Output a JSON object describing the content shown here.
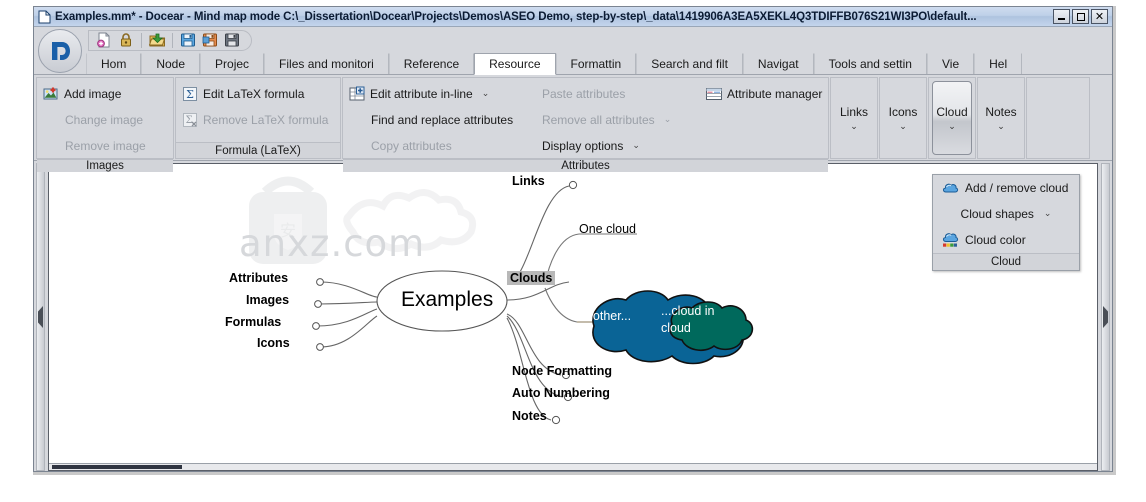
{
  "window": {
    "title": "Examples.mm* - Docear - Mind map mode C:\\_Dissertation\\Docear\\Projects\\Demos\\ASEO Demo, step-by-step\\_data\\1419906A3EA5XEKL4Q3TDIFFB076S21WI3PO\\default...",
    "title_icon": "document-icon",
    "controls": {
      "minimize": "minimize-icon",
      "maximize": "maximize-icon",
      "close": "close-icon"
    }
  },
  "toolbar": {
    "logo": "docear-logo-icon",
    "items": [
      {
        "name": "new-map-icon"
      },
      {
        "name": "lock-icon"
      },
      {
        "name": "open-folder-icon"
      },
      {
        "name": "save-icon"
      },
      {
        "name": "save-as-icon"
      },
      {
        "name": "save-all-icon"
      }
    ]
  },
  "tabs": [
    {
      "label": "Hom",
      "active": false
    },
    {
      "label": "Node",
      "active": false
    },
    {
      "label": "Projec",
      "active": false
    },
    {
      "label": "Files and monitori",
      "active": false
    },
    {
      "label": "Reference",
      "active": false
    },
    {
      "label": "Resource",
      "active": true
    },
    {
      "label": "Formattin",
      "active": false
    },
    {
      "label": "Search and filt",
      "active": false
    },
    {
      "label": "Navigat",
      "active": false
    },
    {
      "label": "Tools and settin",
      "active": false
    },
    {
      "label": "Vie",
      "active": false
    },
    {
      "label": "Hel",
      "active": false
    }
  ],
  "ribbon": {
    "groups": [
      {
        "label": "Images",
        "items": [
          {
            "label": "Add image",
            "icon": "add-image-icon",
            "disabled": false,
            "caret": false
          },
          {
            "label": "Change image",
            "icon": "",
            "disabled": true,
            "caret": false
          },
          {
            "label": "Remove image",
            "icon": "",
            "disabled": true,
            "caret": false
          }
        ]
      },
      {
        "label": "Formula (LaTeX)",
        "items": [
          {
            "label": "Edit LaTeX formula",
            "icon": "sigma-edit-icon",
            "disabled": false,
            "caret": false
          },
          {
            "label": "Remove LaTeX formula",
            "icon": "sigma-remove-icon",
            "disabled": true,
            "caret": false
          }
        ]
      },
      {
        "label": "Attributes",
        "col1": [
          {
            "label": "Edit attribute in-line",
            "icon": "attribute-add-icon",
            "disabled": false,
            "caret": true
          },
          {
            "label": "Find and replace attributes",
            "icon": "",
            "disabled": false,
            "caret": false
          },
          {
            "label": "Copy attributes",
            "icon": "",
            "disabled": true,
            "caret": false
          }
        ],
        "col2": [
          {
            "label": "Paste attributes",
            "icon": "",
            "disabled": true,
            "caret": false
          },
          {
            "label": "Remove all attributes",
            "icon": "",
            "disabled": true,
            "caret": true
          },
          {
            "label": "Display options",
            "icon": "",
            "disabled": false,
            "caret": true
          }
        ],
        "col3": [
          {
            "label": "Attribute manager",
            "icon": "attribute-manager-icon",
            "disabled": false,
            "caret": false
          }
        ]
      }
    ],
    "big_buttons": [
      {
        "label": "Links",
        "active": false,
        "caret": "ˇ"
      },
      {
        "label": "Icons",
        "active": false,
        "caret": "ˇ"
      },
      {
        "label": "Cloud",
        "active": true,
        "caret": "ˇ"
      },
      {
        "label": "Notes",
        "active": false,
        "caret": "ˇ"
      }
    ]
  },
  "cloud_menu": {
    "items": [
      {
        "label": "Add / remove cloud",
        "icon": "cloud-icon",
        "caret": false
      },
      {
        "label": "Cloud shapes",
        "icon": "",
        "caret": true
      },
      {
        "label": "Cloud color",
        "icon": "cloud-color-icon",
        "caret": false
      }
    ],
    "group_label": "Cloud"
  },
  "mindmap": {
    "root": "Examples",
    "left_branches": [
      "Attributes",
      "Images",
      "Formulas",
      "Icons"
    ],
    "right_branches": [
      {
        "label": "Links",
        "selected": false
      },
      {
        "label": "Clouds",
        "selected": true
      },
      {
        "label": "Node Formatting",
        "selected": false
      },
      {
        "label": "Auto Numbering",
        "selected": false
      },
      {
        "label": "Notes",
        "selected": false
      }
    ],
    "cloud_nodes": [
      {
        "label": "One cloud",
        "style": "plain-cloud"
      },
      {
        "label": "another...",
        "style": "blue-cloud"
      },
      {
        "label": "...cloud in cloud",
        "style": "teal-cloud"
      }
    ],
    "colors": {
      "outer_cloud": "#0a6496",
      "inner_cloud": "#00695c",
      "cloud_border": "#1a1a1a",
      "selection": "#b8b8b8"
    }
  },
  "watermark": {
    "text": "anxz.com",
    "logo": "shield-watermark-icon"
  },
  "scrollbar": {
    "horizontal": "hscrollbar"
  }
}
